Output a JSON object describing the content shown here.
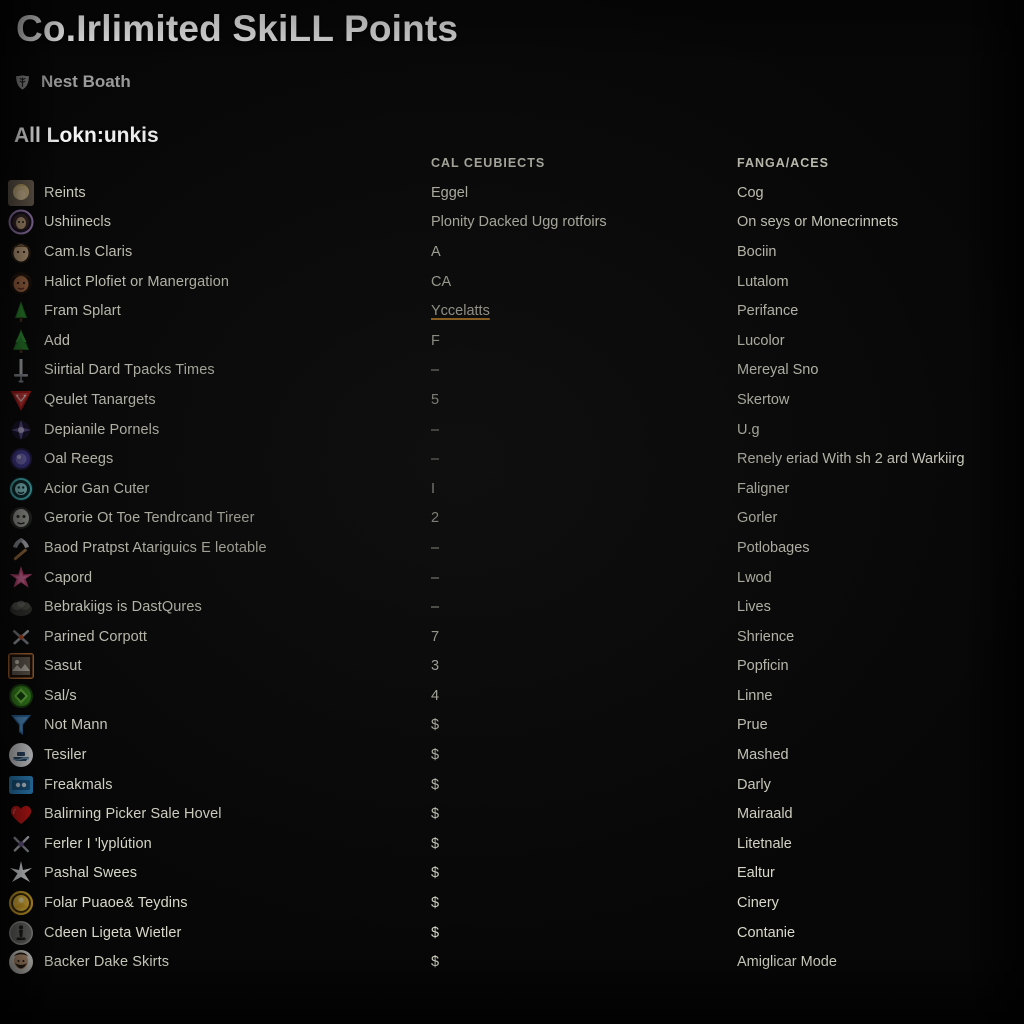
{
  "window": {
    "background": "#070707",
    "text_color": "#d9d9cb"
  },
  "header": {
    "title": "Co.Irlimited SkiLL Points",
    "subtitle_icon": "shield-leaf-icon",
    "subtitle": "Nest Boath",
    "section_title": "All Lokn:unkis"
  },
  "columns": {
    "name_header": "",
    "mid_header": "CAL CEUBIECTS",
    "right_header": "FANGA/ACES"
  },
  "accent": {
    "underline": "#d08a2a"
  },
  "rows": [
    {
      "icon": "portrait-blonde-woman-icon",
      "name": "Reints",
      "mid": "Eggel",
      "right": "Cog"
    },
    {
      "icon": "portrait-purple-halo-icon",
      "name": "Ushiinecls",
      "mid": "Plonity Dacked Ugg rotfoirs",
      "right": "On seys or Monecrinnets"
    },
    {
      "icon": "portrait-tan-face-icon",
      "name": "Cam.Is Claris",
      "mid": "A",
      "right": "Bociin"
    },
    {
      "icon": "portrait-dark-face-icon",
      "name": "Halict Plofiet or Manergation",
      "mid": "CA",
      "right": "Lutalom"
    },
    {
      "icon": "pine-tree-small-icon",
      "name": "Fram Splart",
      "mid": "Yccelatts",
      "right": "Perifance",
      "mid_underlined": true
    },
    {
      "icon": "pine-tree-large-icon",
      "name": "Add",
      "mid": "F",
      "right": "Lucolor"
    },
    {
      "icon": "sword-icon",
      "name": "Siirtial Dard Tpacks Times",
      "mid": "–",
      "right": "Mereyal Sno"
    },
    {
      "icon": "red-triangle-icon",
      "name": "Qeulet Tanargets",
      "mid": "5",
      "right": "Skertow"
    },
    {
      "icon": "purple-burst-icon",
      "name": "Depianile Pornels",
      "mid": "–",
      "right": "U.g"
    },
    {
      "icon": "blue-orb-icon",
      "name": "Oal Reegs",
      "mid": "–",
      "right": "Renely eriad With sh 2 ard Warkiirg"
    },
    {
      "icon": "teal-circle-emblem-icon",
      "name": "Acior Gan Cuter",
      "mid": "I",
      "right": "Faligner"
    },
    {
      "icon": "grey-mask-icon",
      "name": "Gerorie Ot Toe Tendrcand Tireer",
      "mid": "2",
      "right": "Gorler"
    },
    {
      "icon": "pickaxe-icon",
      "name": "Baod Pratpst Atariguics E leotable",
      "mid": "–",
      "right": "Potlobages"
    },
    {
      "icon": "pink-star-icon",
      "name": "Capord",
      "mid": "–",
      "right": "Lwod"
    },
    {
      "icon": "grey-smoke-icon",
      "name": "Bebrakiigs is DastQures",
      "mid": "–",
      "right": "Lives"
    },
    {
      "icon": "crossed-weapons-icon",
      "name": "Parined Corpott",
      "mid": "7",
      "right": "Shrience"
    },
    {
      "icon": "framed-picture-icon",
      "name": "Sasut",
      "mid": "3",
      "right": "Popficin"
    },
    {
      "icon": "green-gem-icon",
      "name": "Sal/s",
      "mid": "4",
      "right": "Linne"
    },
    {
      "icon": "blue-funnel-icon",
      "name": "Not Mann",
      "mid": "$",
      "right": "Prue"
    },
    {
      "icon": "white-circle-boat-icon",
      "name": "Tesiler",
      "mid": "$",
      "right": "Mashed"
    },
    {
      "icon": "blue-card-icon",
      "name": "Freakmals",
      "mid": "$",
      "right": "Darly"
    },
    {
      "icon": "red-heart-icon",
      "name": "Balirning Picker Sale Hovel",
      "mid": "$",
      "right": "Mairaald"
    },
    {
      "icon": "crossed-swords-icon",
      "name": "Ferler I 'lyplútion",
      "mid": "$",
      "right": "Litetnale"
    },
    {
      "icon": "white-burst-icon",
      "name": "Pashal Swees",
      "mid": "$",
      "right": "Ealtur"
    },
    {
      "icon": "gold-medallion-icon",
      "name": "Folar Puaoe& Teydins",
      "mid": "$",
      "right": "Cinery"
    },
    {
      "icon": "grey-chess-piece-icon",
      "name": "Cdeen Ligeta Wietler",
      "mid": "$",
      "right": "Contanie"
    },
    {
      "icon": "portrait-bearded-man-icon",
      "name": "Backer Dake Skirts",
      "mid": "$",
      "right": "Amiglicar Mode"
    }
  ]
}
